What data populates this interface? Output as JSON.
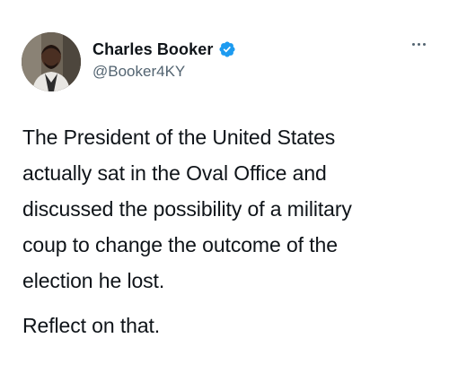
{
  "tweet": {
    "author": {
      "display_name": "Charles Booker",
      "handle": "@Booker4KY",
      "verified": true,
      "avatar_icon": "profile-photo"
    },
    "more_icon": "more-dots-icon",
    "text": {
      "paragraph_1": "The President of the United States\nactually sat in the Oval Office and\ndiscussed the possibility of a military\ncoup to change the outcome of the\nelection he lost.",
      "paragraph_2": "Reflect on that."
    },
    "colors": {
      "text": "#0f1419",
      "secondary": "#536471",
      "verified_badge": "#1d9bf0"
    }
  }
}
